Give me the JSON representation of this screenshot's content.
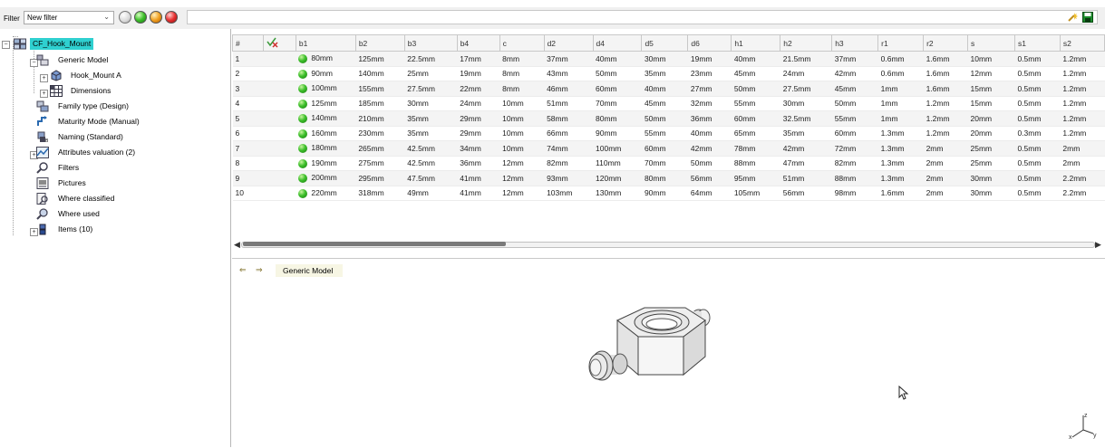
{
  "filter": {
    "label": "Filter",
    "selected": "New filter",
    "status_balls": [
      "none",
      "green",
      "orange",
      "red"
    ]
  },
  "tree": {
    "root": "CF_Hook_Mount",
    "items": [
      {
        "label": "Generic Model"
      },
      {
        "label": "Hook_Mount A"
      },
      {
        "label": "Dimensions"
      },
      {
        "label": "Family type (Design)"
      },
      {
        "label": "Maturity Mode (Manual)"
      },
      {
        "label": "Naming (Standard)"
      },
      {
        "label": "Attributes valuation (2)"
      },
      {
        "label": "Filters"
      },
      {
        "label": "Pictures"
      },
      {
        "label": "Where classified"
      },
      {
        "label": "Where used"
      },
      {
        "label": "Items (10)"
      }
    ]
  },
  "grid": {
    "columns": [
      "#",
      "",
      "b1",
      "b2",
      "b3",
      "b4",
      "c",
      "d2",
      "d4",
      "d5",
      "d6",
      "h1",
      "h2",
      "h3",
      "r1",
      "r2",
      "s",
      "s1",
      "s2"
    ],
    "rows": [
      [
        "1",
        "80mm",
        "125mm",
        "22.5mm",
        "17mm",
        "8mm",
        "37mm",
        "40mm",
        "30mm",
        "19mm",
        "40mm",
        "21.5mm",
        "37mm",
        "0.6mm",
        "1.6mm",
        "10mm",
        "0.5mm",
        "1.2mm"
      ],
      [
        "2",
        "90mm",
        "140mm",
        "25mm",
        "19mm",
        "8mm",
        "43mm",
        "50mm",
        "35mm",
        "23mm",
        "45mm",
        "24mm",
        "42mm",
        "0.6mm",
        "1.6mm",
        "12mm",
        "0.5mm",
        "1.2mm"
      ],
      [
        "3",
        "100mm",
        "155mm",
        "27.5mm",
        "22mm",
        "8mm",
        "46mm",
        "60mm",
        "40mm",
        "27mm",
        "50mm",
        "27.5mm",
        "45mm",
        "1mm",
        "1.6mm",
        "15mm",
        "0.5mm",
        "1.2mm"
      ],
      [
        "4",
        "125mm",
        "185mm",
        "30mm",
        "24mm",
        "10mm",
        "51mm",
        "70mm",
        "45mm",
        "32mm",
        "55mm",
        "30mm",
        "50mm",
        "1mm",
        "1.2mm",
        "15mm",
        "0.5mm",
        "1.2mm"
      ],
      [
        "5",
        "140mm",
        "210mm",
        "35mm",
        "29mm",
        "10mm",
        "58mm",
        "80mm",
        "50mm",
        "36mm",
        "60mm",
        "32.5mm",
        "55mm",
        "1mm",
        "1.2mm",
        "20mm",
        "0.5mm",
        "1.2mm"
      ],
      [
        "6",
        "160mm",
        "230mm",
        "35mm",
        "29mm",
        "10mm",
        "66mm",
        "90mm",
        "55mm",
        "40mm",
        "65mm",
        "35mm",
        "60mm",
        "1.3mm",
        "1.2mm",
        "20mm",
        "0.3mm",
        "1.2mm"
      ],
      [
        "7",
        "180mm",
        "265mm",
        "42.5mm",
        "34mm",
        "10mm",
        "74mm",
        "100mm",
        "60mm",
        "42mm",
        "78mm",
        "42mm",
        "72mm",
        "1.3mm",
        "2mm",
        "25mm",
        "0.5mm",
        "2mm"
      ],
      [
        "8",
        "190mm",
        "275mm",
        "42.5mm",
        "36mm",
        "12mm",
        "82mm",
        "110mm",
        "70mm",
        "50mm",
        "88mm",
        "47mm",
        "82mm",
        "1.3mm",
        "2mm",
        "25mm",
        "0.5mm",
        "2mm"
      ],
      [
        "9",
        "200mm",
        "295mm",
        "47.5mm",
        "41mm",
        "12mm",
        "93mm",
        "120mm",
        "80mm",
        "56mm",
        "95mm",
        "51mm",
        "88mm",
        "1.3mm",
        "2mm",
        "30mm",
        "0.5mm",
        "2.2mm"
      ],
      [
        "10",
        "220mm",
        "318mm",
        "49mm",
        "41mm",
        "12mm",
        "103mm",
        "130mm",
        "90mm",
        "64mm",
        "105mm",
        "56mm",
        "98mm",
        "1.6mm",
        "2mm",
        "30mm",
        "0.5mm",
        "2.2mm"
      ]
    ]
  },
  "viewer": {
    "title": "Generic Model",
    "axis_z": "z",
    "axis_x": "x",
    "axis_y": "y"
  },
  "colors": {
    "root_highlight": "#2fd0d0",
    "status_green": "#3cbf2a"
  }
}
